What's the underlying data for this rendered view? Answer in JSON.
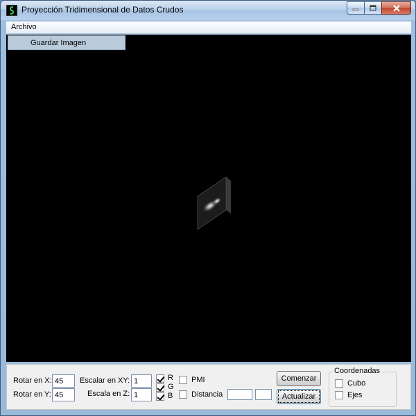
{
  "window": {
    "title": "Proyección Tridimensional de Datos Crudos"
  },
  "menu": {
    "items": [
      {
        "label": "Archivo"
      }
    ]
  },
  "dropdown": {
    "items": [
      {
        "label": "Guardar Imagen"
      }
    ]
  },
  "controls": {
    "rot_x": {
      "label": "Rotar en X:",
      "value": "45"
    },
    "rot_y": {
      "label": "Rotar en Y:",
      "value": "45"
    },
    "scale_xy": {
      "label": "Escalar en XY:",
      "value": "1"
    },
    "scale_z": {
      "label": "Escala en Z:",
      "value": "1"
    },
    "channels": [
      {
        "label": "R",
        "checked": true
      },
      {
        "label": "G",
        "checked": true
      },
      {
        "label": "B",
        "checked": true
      }
    ],
    "pmi": {
      "label": "PMI",
      "checked": false
    },
    "distancia": {
      "label": "Distancia",
      "checked": false,
      "value1": "",
      "value2": ""
    },
    "comenzar_label": "Comenzar",
    "actualizar_label": "Actualizar",
    "coordenadas": {
      "title": "Coordenadas",
      "cubo": {
        "label": "Cubo",
        "checked": false
      },
      "ejes": {
        "label": "Ejes",
        "checked": false
      }
    }
  },
  "icons": {
    "app": "app-icon",
    "minimize": "minimize-icon",
    "maximize": "maximize-icon",
    "close": "close-icon"
  }
}
